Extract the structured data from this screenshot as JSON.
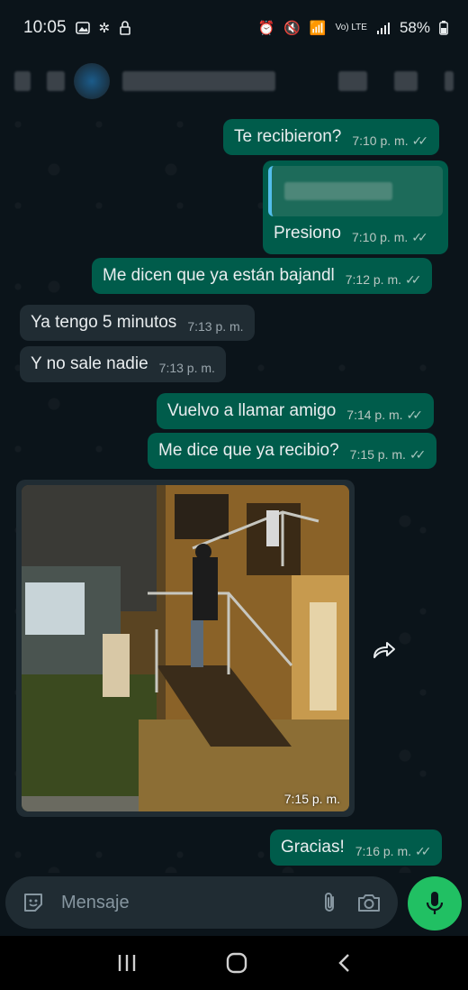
{
  "status_bar": {
    "time": "10:05",
    "battery": "58%",
    "network": "Vo) LTE"
  },
  "input": {
    "placeholder": "Mensaje"
  },
  "messages": [
    {
      "text": "Te recibieron?",
      "time": "7:10 p. m.",
      "direction": "outgoing"
    },
    {
      "text": "Presiono",
      "time": "7:10 p. m.",
      "direction": "outgoing"
    },
    {
      "text": "Me dicen que ya están bajandl",
      "time": "7:12 p. m.",
      "direction": "outgoing"
    },
    {
      "text": "Ya tengo 5 minutos",
      "time": "7:13 p. m.",
      "direction": "incoming"
    },
    {
      "text": "Y no sale nadie",
      "time": "7:13 p. m.",
      "direction": "incoming"
    },
    {
      "text": "Vuelvo a llamar amigo",
      "time": "7:14 p. m.",
      "direction": "outgoing"
    },
    {
      "text": "Me dice que ya recibio?",
      "time": "7:15 p. m.",
      "direction": "outgoing"
    },
    {
      "text": "",
      "time": "7:15 p. m.",
      "direction": "incoming"
    },
    {
      "text": "Gracias!",
      "time": "7:16 p. m.",
      "direction": "outgoing"
    }
  ],
  "colors": {
    "background": "#0b141a",
    "outgoing_bubble": "#005c4b",
    "incoming_bubble": "#202c33",
    "accent": "#21c063"
  },
  "icons": {
    "sticker": "sticker-icon",
    "attach": "paperclip-icon",
    "camera": "camera-icon",
    "mic": "mic-icon",
    "forward": "forward-icon"
  }
}
